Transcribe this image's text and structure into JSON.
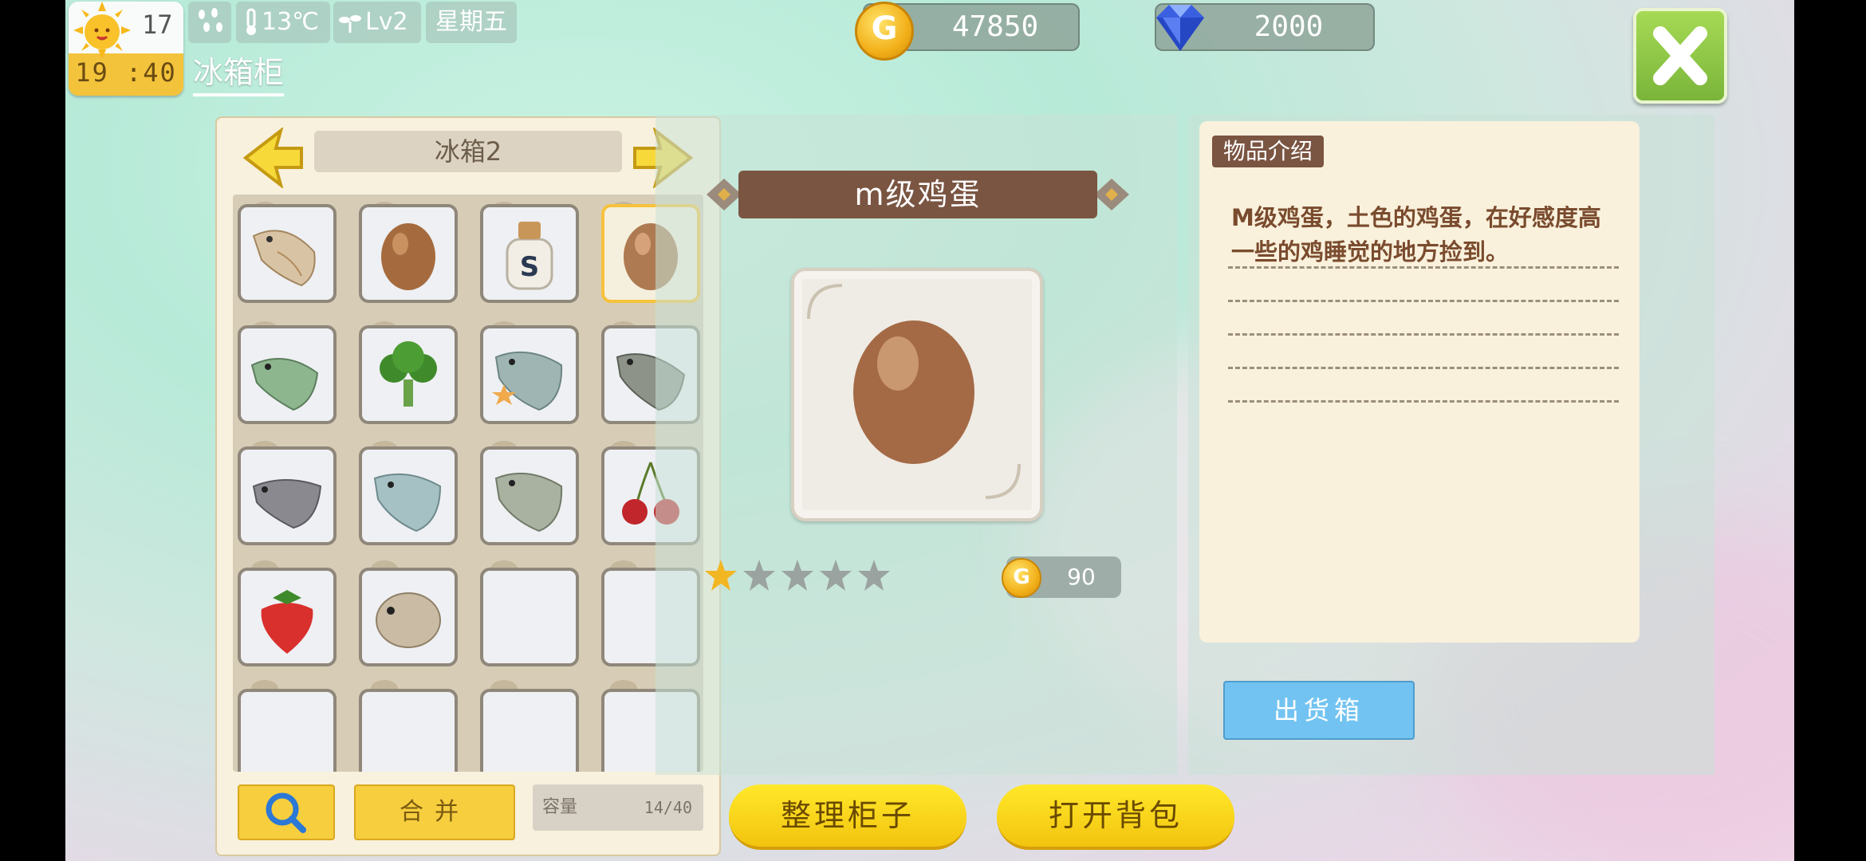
{
  "hud": {
    "day": "17",
    "time": "19 :40",
    "temperature": "13℃",
    "level": "Lv2",
    "weekday": "星期五",
    "weather_icon": "sun-icon",
    "rain_icon": "rain-drops-icon"
  },
  "page_title": "冰箱柜",
  "currency": {
    "gold": "47850",
    "gold_coin_symbol": "G",
    "diamonds": "2000"
  },
  "fridge": {
    "name": "冰箱2",
    "prev_icon": "arrow-left-icon",
    "next_icon": "arrow-right-icon",
    "slots": [
      {
        "item": "fish-icon"
      },
      {
        "item": "egg-icon"
      },
      {
        "item": "milk-bottle-icon"
      },
      {
        "item": "egg-icon",
        "selected": true
      },
      {
        "item": "green-fish-icon"
      },
      {
        "item": "broccoli-icon"
      },
      {
        "item": "carp-icon",
        "star": true
      },
      {
        "item": "catfish-icon"
      },
      {
        "item": "catfish-icon"
      },
      {
        "item": "blue-fish-icon"
      },
      {
        "item": "carp-icon"
      },
      {
        "item": "cherry-icon"
      },
      {
        "item": "strawberry-icon"
      },
      {
        "item": "pufferfish-icon"
      },
      {
        "item": ""
      },
      {
        "item": ""
      },
      {
        "item": ""
      },
      {
        "item": ""
      },
      {
        "item": ""
      },
      {
        "item": ""
      }
    ],
    "merge_label": "合并",
    "capacity_label": "容量",
    "capacity_value": "14/40"
  },
  "item_detail": {
    "name": "m级鸡蛋",
    "rating": 1,
    "max_rating": 5,
    "price": "90",
    "price_coin_symbol": "G"
  },
  "description": {
    "label": "物品介绍",
    "text": "M级鸡蛋，土色的鸡蛋，在好感度高一些的鸡睡觉的地方捡到。"
  },
  "buttons": {
    "ship_box": "出货箱",
    "organize": "整理柜子",
    "open_bag": "打开背包"
  },
  "colors": {
    "accent_yellow": "#f7ce3e",
    "banner_brown": "#7a5542",
    "close_green": "#8cc645",
    "ship_blue": "#72c3f1"
  }
}
